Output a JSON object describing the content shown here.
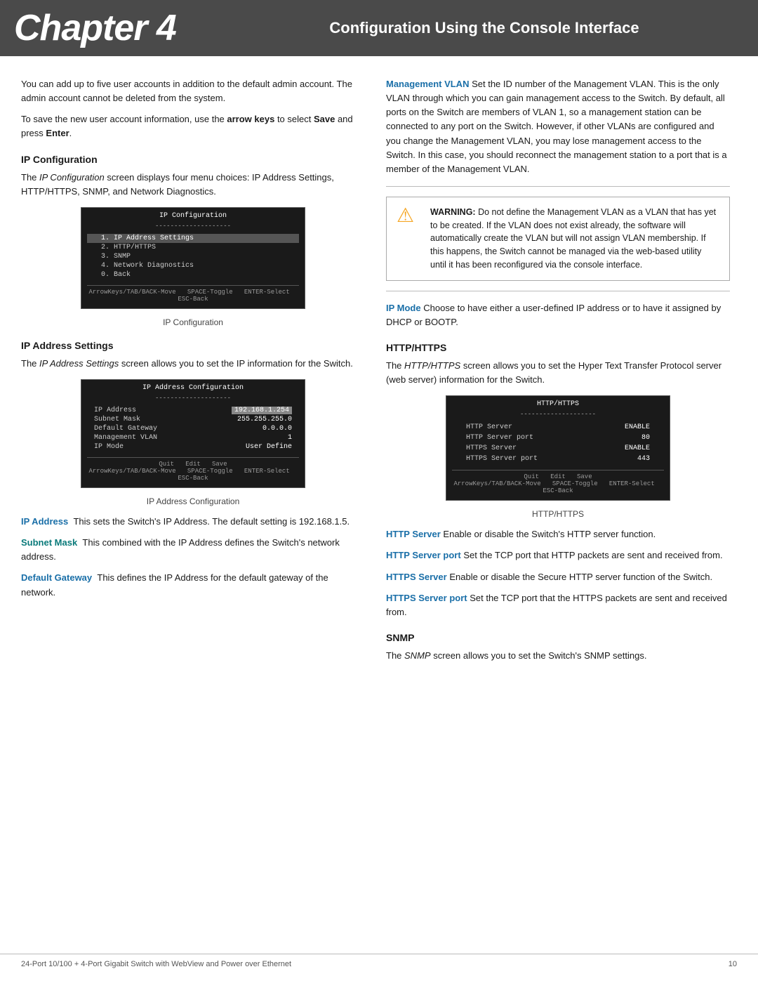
{
  "header": {
    "chapter": "Chapter 4",
    "title": "Configuration Using the Console Interface"
  },
  "footer": {
    "left": "24-Port 10/100 + 4-Port Gigabit Switch with WebView and Power over Ethernet",
    "right": "10"
  },
  "left_col": {
    "intro_p1": "You can add up to five user accounts in addition to the default admin account. The admin account cannot be deleted from the system.",
    "intro_p2_prefix": "To save the new user account information, use the ",
    "intro_p2_bold1": "arrow keys",
    "intro_p2_mid": " to select ",
    "intro_p2_bold2": "Save",
    "intro_p2_end": " and press ",
    "intro_p2_bold3": "Enter",
    "intro_p2_period": ".",
    "ip_config_title": "IP Configuration",
    "ip_config_p1_prefix": "The ",
    "ip_config_p1_italic": "IP Configuration",
    "ip_config_p1_rest": " screen displays four menu choices: IP Address Settings, HTTP/HTTPS, SNMP, and Network Diagnostics.",
    "ip_config_screenshot": {
      "title": "IP Configuration",
      "subtitle": "--------------------",
      "menu": [
        {
          "label": "1. IP Address Settings",
          "active": true
        },
        {
          "label": "2. HTTP/HTTPS",
          "active": false
        },
        {
          "label": "3. SNMP",
          "active": false
        },
        {
          "label": "4. Network Diagnostics",
          "active": false
        },
        {
          "label": "0. Back",
          "active": false
        }
      ],
      "footer": "ArrowKeys/TAB/BACK-Move  SPACE-Toggle  ENTER-Select  ESC-Back"
    },
    "ip_config_caption": "IP Configuration",
    "ip_address_settings_title": "IP Address Settings",
    "ip_address_p1_prefix": "The ",
    "ip_address_p1_italic": "IP Address Settings",
    "ip_address_p1_rest": " screen allows you to set the IP information for the Switch.",
    "ip_address_screenshot": {
      "title": "IP Address Configuration",
      "subtitle": "--------------------",
      "rows": [
        {
          "key": "IP Address",
          "value": "192.168.1.254",
          "highlight": true
        },
        {
          "key": "Subnet Mask",
          "value": "255.255.255.0"
        },
        {
          "key": "Default Gateway",
          "value": "0.0.0.0"
        },
        {
          "key": "Management VLAN",
          "value": "1"
        },
        {
          "key": "IP Mode",
          "value": "User Define"
        }
      ],
      "footer_menu": "Quit  Edit  Save",
      "footer_nav": "ArrowKeys/TAB/BACK-Move  SPACE-Toggle  ENTER-Select  ESC-Back"
    },
    "ip_address_caption": "IP Address Configuration",
    "ip_address_term": "IP Address",
    "ip_address_desc": "This sets the Switch's IP Address. The default setting is 192.168.1.5.",
    "subnet_mask_term": "Subnet Mask",
    "subnet_mask_desc": "This combined with the IP Address defines the Switch's network address.",
    "default_gateway_term": "Default Gateway",
    "default_gateway_desc": "This defines the IP Address for the default gateway of the network."
  },
  "right_col": {
    "mgmt_vlan_term": "Management VLAN",
    "mgmt_vlan_desc": " Set the ID number of the Management VLAN. This is the only VLAN through which you can gain management access to the Switch. By default, all ports on the Switch are members of VLAN 1, so a management station can be connected to any port on the Switch. However, if other VLANs are configured and you change the Management VLAN, you may lose management access to the Switch. In this case, you should reconnect the management station to a port that is a member of the Management VLAN.",
    "warning_label": "WARNING:",
    "warning_text": " Do not define the Management VLAN as a VLAN that has yet to be created. If the VLAN does not exist already, the software will automatically create the VLAN but will not assign VLAN membership. If this happens, the Switch cannot be managed via the web-based utility until it has been reconfigured via the console interface.",
    "ip_mode_term": "IP Mode",
    "ip_mode_desc": " Choose to have either a user-defined IP address or to have it assigned by DHCP or BOOTP.",
    "http_https_title": "HTTP/HTTPS",
    "http_https_p1_prefix": "The ",
    "http_https_p1_italic": "HTTP/HTTPS",
    "http_https_p1_rest": " screen allows you to set the Hyper Text Transfer Protocol server (web server) information for the Switch.",
    "http_screenshot": {
      "title": "HTTP/HTTPS",
      "rows": [
        {
          "key": "HTTP Server",
          "value": "ENABLE"
        },
        {
          "key": "HTTP Server port",
          "value": "80"
        },
        {
          "key": "HTTPS Server",
          "value": "ENABLE"
        },
        {
          "key": "HTTPS Server port",
          "value": "443"
        }
      ],
      "footer_menu": "Quit  Edit  Save",
      "footer_nav": "ArrowKeys/TAB/BACK-Move  SPACE-Toggle  ENTER-Select  ESC-Back"
    },
    "http_caption": "HTTP/HTTPS",
    "http_server_term": "HTTP Server",
    "http_server_desc": " Enable or disable the Switch's HTTP server function.",
    "http_port_term": "HTTP Server port",
    "http_port_desc": " Set the TCP port that HTTP packets are sent and received from.",
    "https_server_term": "HTTPS Server",
    "https_server_desc": " Enable or disable the Secure HTTP server function of the Switch.",
    "https_port_term": "HTTPS Server port",
    "https_port_desc": " Set the TCP port that the HTTPS packets are sent and received from.",
    "snmp_title": "SNMP",
    "snmp_p1_prefix": "The ",
    "snmp_p1_italic": "SNMP",
    "snmp_p1_rest": " screen allows you to set the Switch's SNMP settings."
  }
}
